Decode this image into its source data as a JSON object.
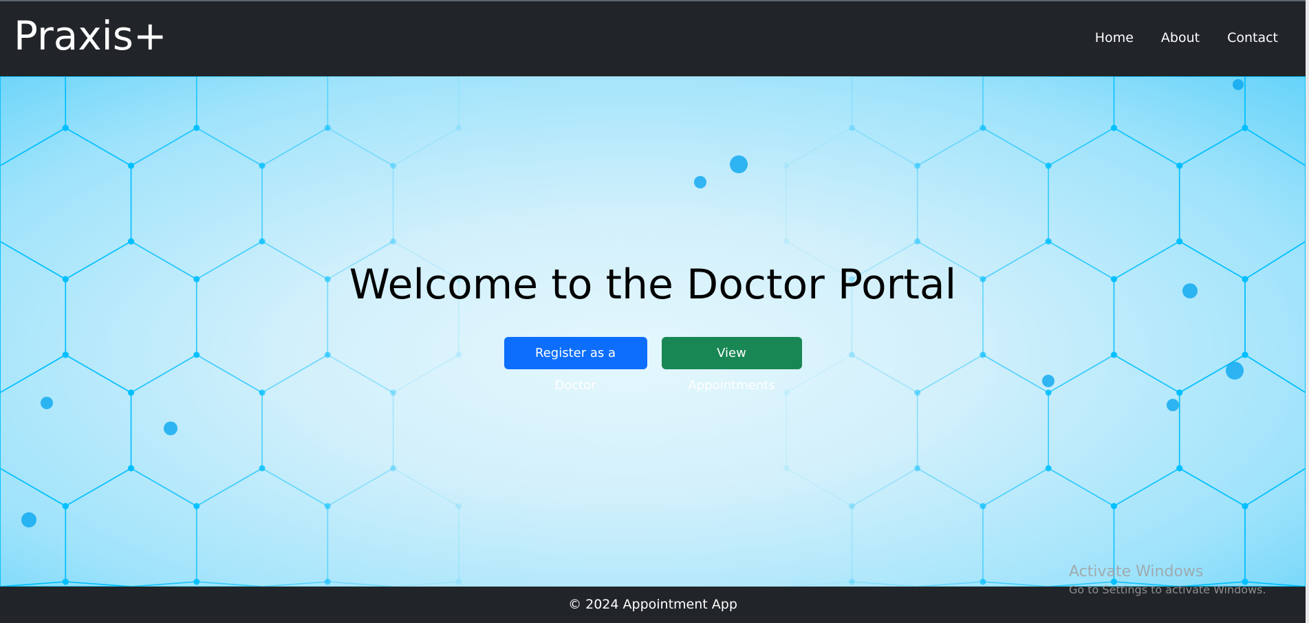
{
  "navbar": {
    "brand": "Praxis+",
    "links": [
      "Home",
      "About",
      "Contact"
    ]
  },
  "hero": {
    "title": "Welcome to the Doctor Portal",
    "register_label": "Register as a Doctor",
    "appointments_label": "View Appointments"
  },
  "footer": {
    "text": "© 2024 Appointment App"
  },
  "watermark": {
    "title": "Activate Windows",
    "subtitle": "Go to Settings to activate Windows."
  },
  "colors": {
    "navbar": "#212529",
    "primary": "#0d6efd",
    "success": "#198754",
    "hex_line": "#00bfff"
  }
}
